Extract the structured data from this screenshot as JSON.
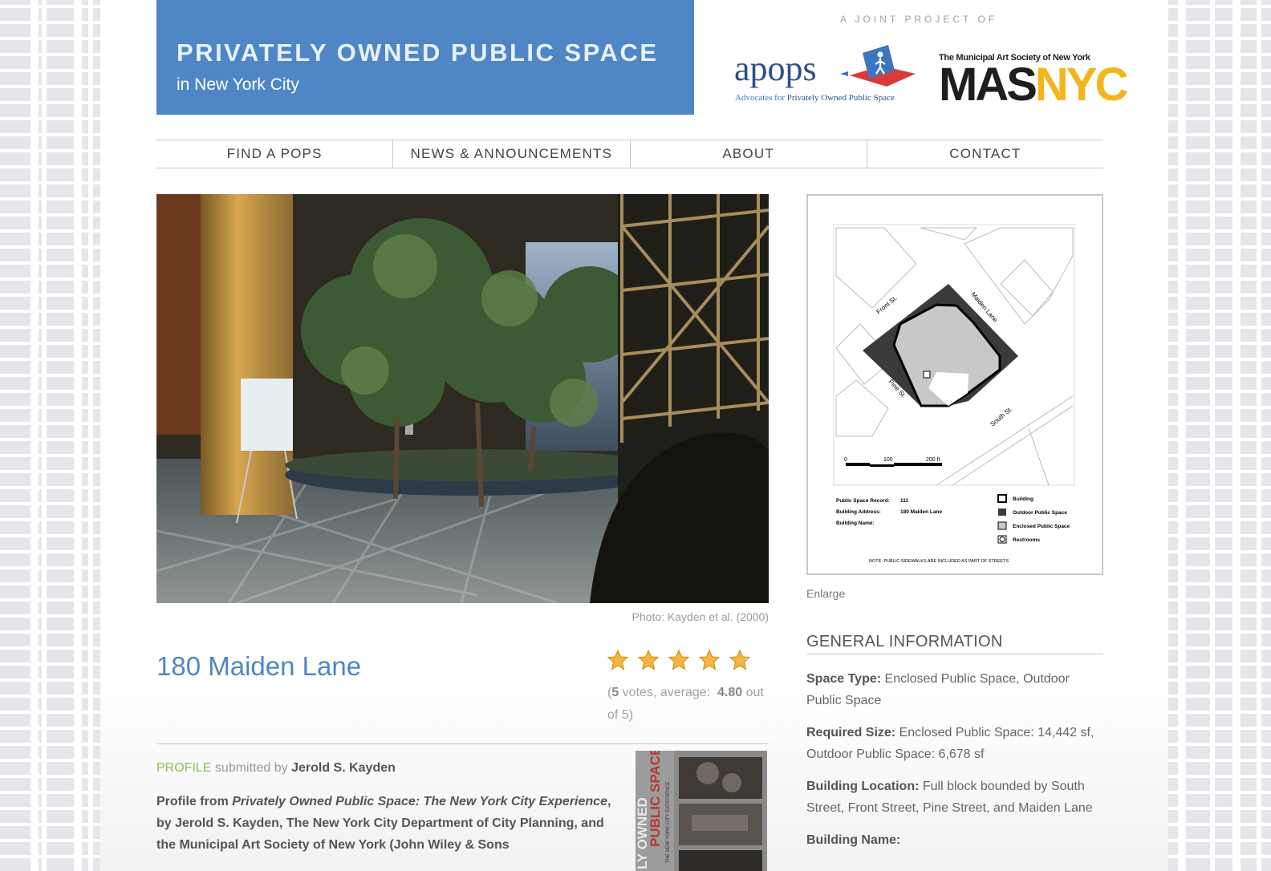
{
  "header": {
    "title": "PRIVATELY OWNED PUBLIC SPACE",
    "subtitle": "in New York City",
    "joint_label": "A JOINT PROJECT OF",
    "apops": {
      "name": "apops",
      "tagline_prefix": "Advocates for ",
      "tagline": "Privately Owned Public Space"
    },
    "mas": {
      "top_line": "The Municipal Art Society of New York",
      "mas": "MAS",
      "nyc": "NYC"
    }
  },
  "nav": [
    {
      "label": "FIND A POPS"
    },
    {
      "label": "NEWS & ANNOUNCEMENTS"
    },
    {
      "label": "ABOUT"
    },
    {
      "label": "CONTACT"
    }
  ],
  "photo": {
    "caption": "Photo: Kayden et al. (2000)"
  },
  "map": {
    "streets": {
      "front": "Front St.",
      "maiden": "Maiden Lane",
      "pine": "Pine St.",
      "south": "South St."
    },
    "scale": {
      "s0": "0",
      "s1": "100",
      "s2": "200 ft"
    },
    "record_label": "Public Space Record:",
    "record_value": "111",
    "address_label": "Building Address:",
    "address_value": "180 Maiden Lane",
    "name_label": "Building Name:",
    "legend": {
      "building": "Building",
      "outdoor": "Outdoor Public Space",
      "enclosed": "Enclosed Public Space",
      "restrooms": "Restrooms"
    },
    "note": "NOTE: PUBLIC SIDEWALKS ARE INCLUDED AS PART OF STREETS",
    "enlarge": "Enlarge"
  },
  "pops": {
    "title": "180 Maiden Lane",
    "rating": {
      "stars": 4.8,
      "open": "(",
      "votes": "5",
      "votes_label": " votes, average: ",
      "average": "4.80",
      "out_of": "out of 5)"
    }
  },
  "profile": {
    "label": "PROFILE",
    "submitted_by": " submitted by ",
    "author": "Jerold S. Kayden",
    "body_prefix": "Profile from ",
    "book_title": "Privately Owned Public Space: The New York City Experience",
    "body_rest": ", by Jerold S. Kayden, The New York City Department of City Planning, and the Municipal Art Society of New York (John Wiley & Sons",
    "cover_line1": "PUBLIC SPACE",
    "cover_line2": "LY OWNED",
    "cover_line3": "THE NEW YORK CITY EXPERIENCE"
  },
  "general_info": {
    "heading": "GENERAL INFORMATION",
    "rows": [
      {
        "label": "Space Type:",
        "value": " Enclosed Public Space, Outdoor Public Space"
      },
      {
        "label": "Required Size:",
        "value": " Enclosed Public Space: 14,442 sf, Outdoor Public Space: 6,678 sf"
      },
      {
        "label": "Building Location:",
        "value": " Full block bounded by South Street, Front Street, Pine Street, and Maiden Lane"
      },
      {
        "label": "Building Name:",
        "value": ""
      }
    ]
  },
  "colors": {
    "brand_blue": "#4f86c6",
    "profile_green": "#8cc152",
    "star_gold": "#f4b63f",
    "nyc_yellow": "#f2b51b"
  }
}
